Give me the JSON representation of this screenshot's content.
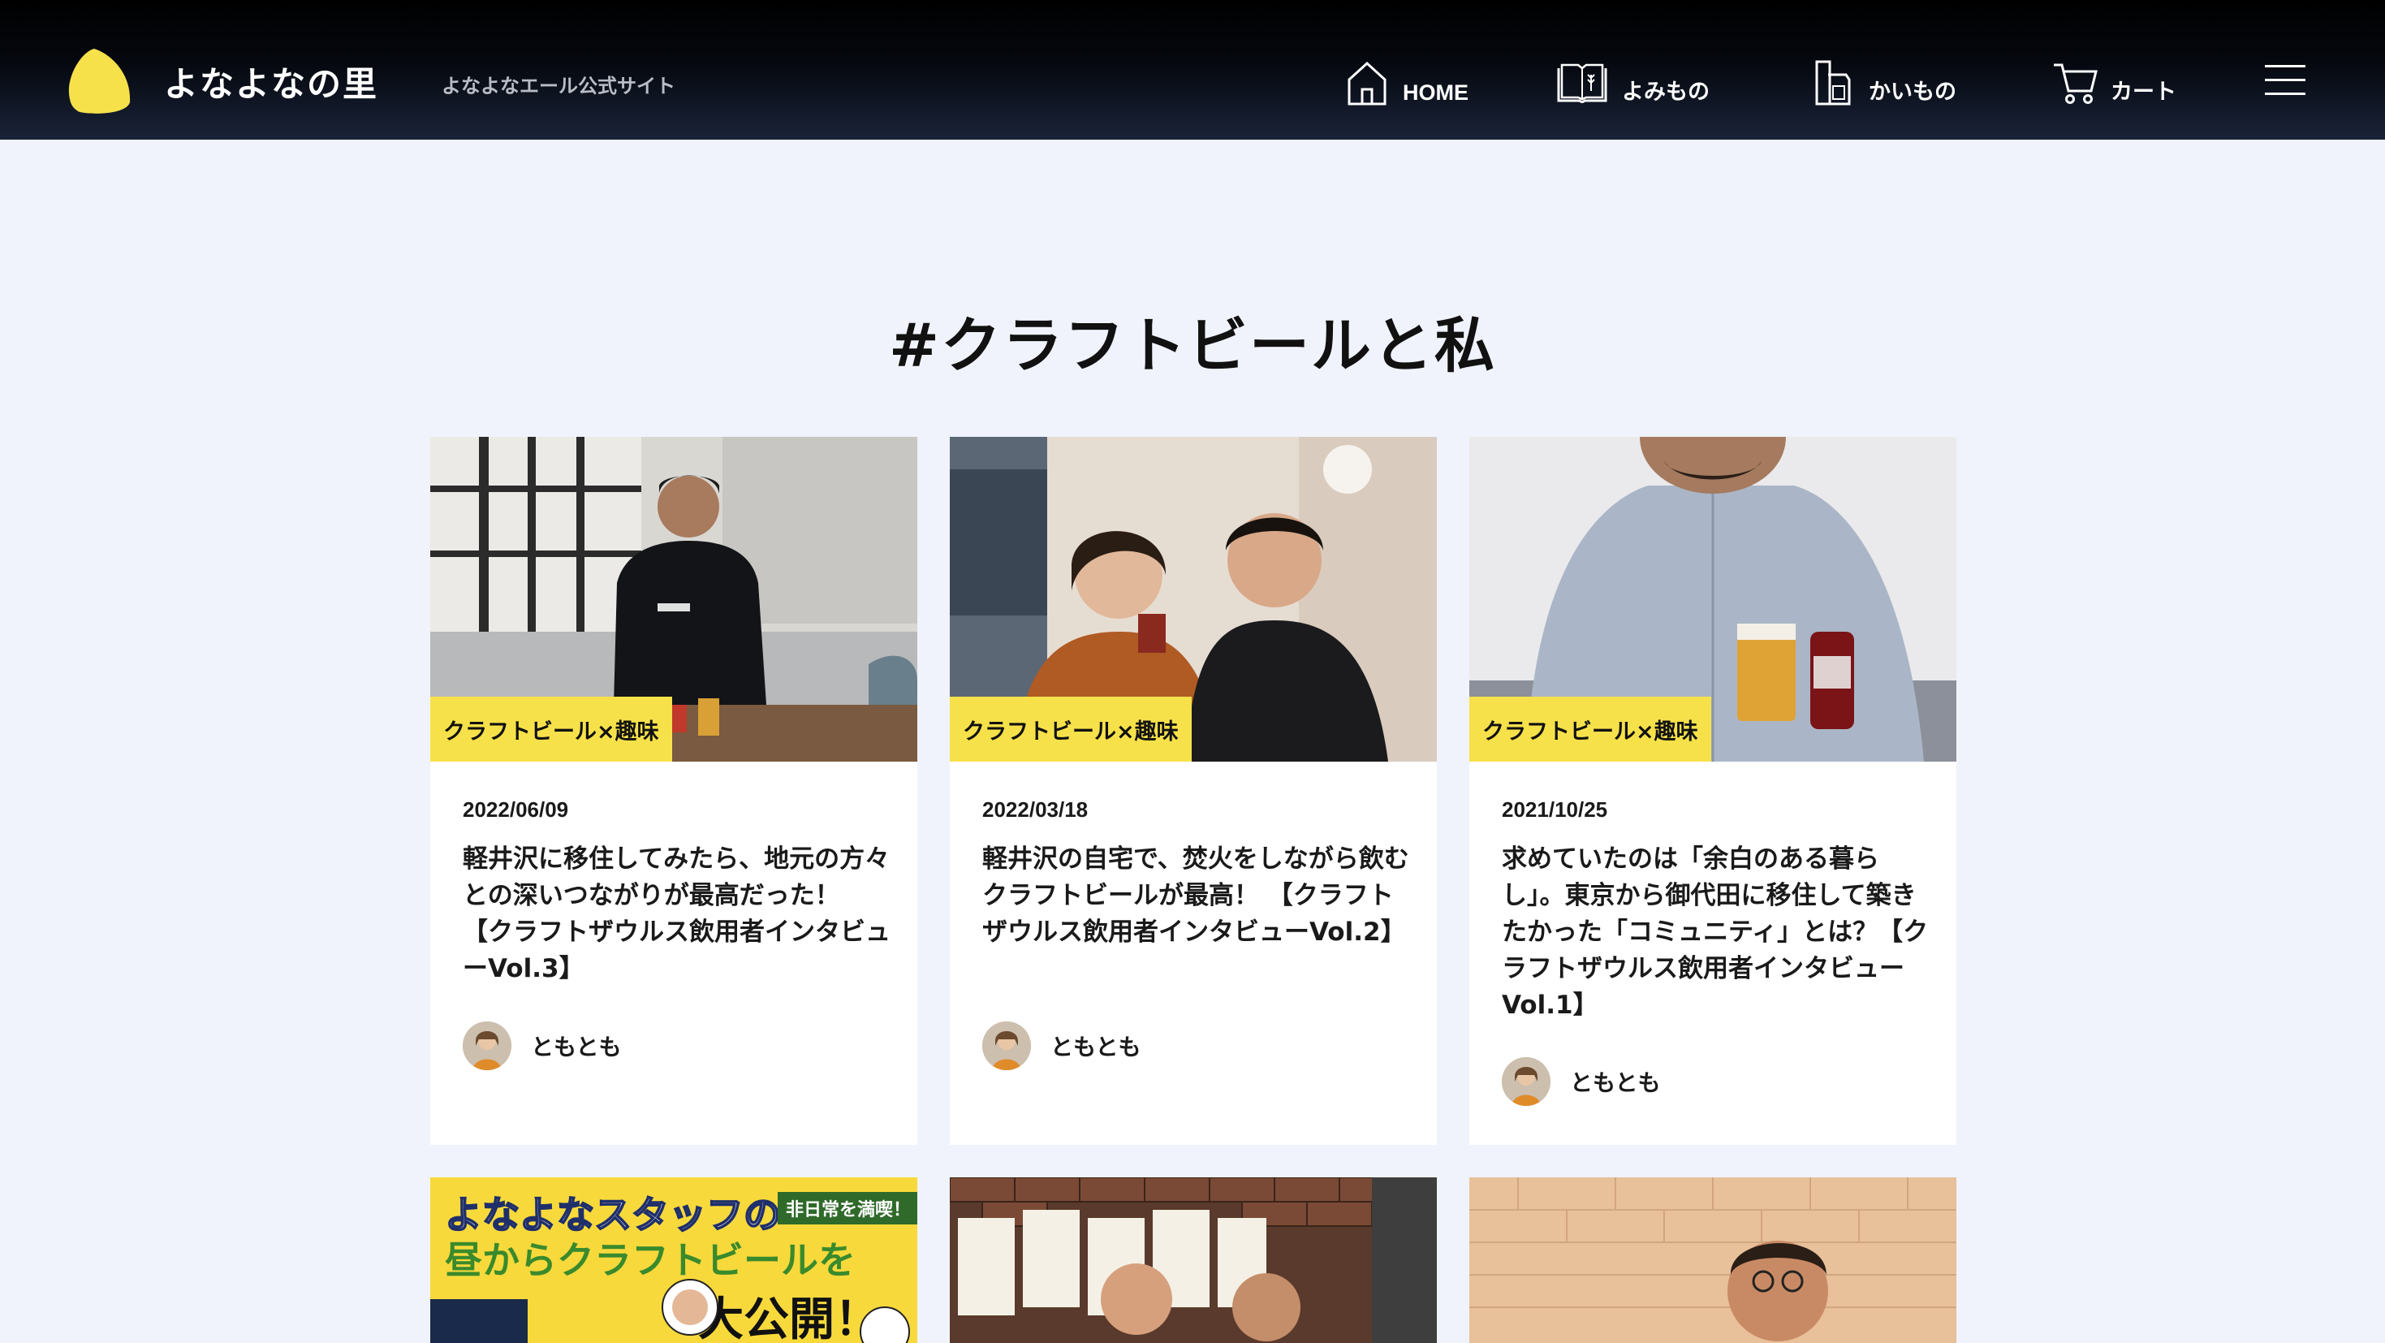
{
  "header": {
    "site_title": "よなよなの里",
    "tagline": "よなよなエール公式サイト",
    "nav": [
      {
        "label": "HOME",
        "icon": "home-icon"
      },
      {
        "label": "よみもの",
        "icon": "book-icon"
      },
      {
        "label": "かいもの",
        "icon": "shopping-bag-icon"
      },
      {
        "label": "カート",
        "icon": "cart-icon"
      }
    ],
    "menu_icon": "hamburger-menu-icon"
  },
  "page": {
    "title": "#クラフトビールと私"
  },
  "cards": [
    {
      "category": "クラフトビール×趣味",
      "date": "2022/06/09",
      "title": "軽井沢に移住してみたら、地元の方々との深いつながりが最高だった！ 【クラフトザウルス飲用者インタビューVol.3】",
      "author": "ともとも"
    },
    {
      "category": "クラフトビール×趣味",
      "date": "2022/03/18",
      "title": "軽井沢の自宅で、焚火をしながら飲むクラフトビールが最高！ 【クラフトザウルス飲用者インタビューVol.2】",
      "author": "ともとも"
    },
    {
      "category": "クラフトビール×趣味",
      "date": "2021/10/25",
      "title": "求めていたのは「余白のある暮らし」。東京から御代田に移住して築きたかった「コミュニティ」とは？【クラフトザウルス飲用者インタビューVol.1】",
      "author": "ともとも"
    }
  ],
  "promo_card": {
    "line1": "よなよなスタッフの",
    "line2": "昼からクラフトビールを",
    "badge": "非日常を満喫！",
    "big": "大公開！"
  },
  "colors": {
    "accent_yellow": "#f7e14a",
    "header_bg": "#000000",
    "page_bg": "#f0f3fb"
  }
}
